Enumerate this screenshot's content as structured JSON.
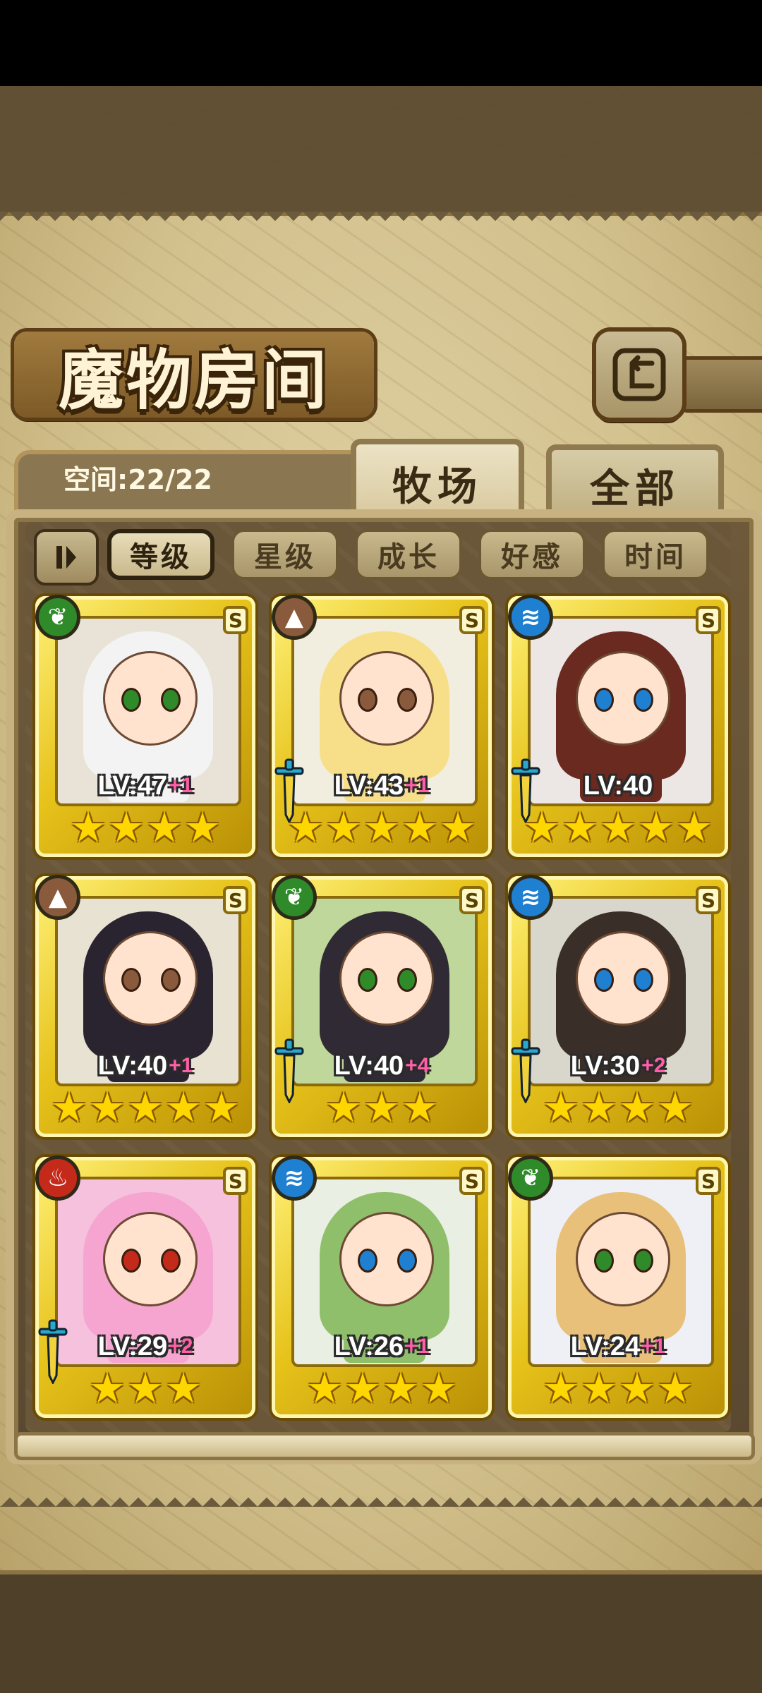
{
  "header": {
    "title": "魔物房间",
    "capacity_label": "空间:22/22"
  },
  "tabs": [
    {
      "label": "牧场",
      "active": true
    },
    {
      "label": "全部",
      "active": false
    }
  ],
  "sort": {
    "toggle_icon": "pause-sort-icon",
    "buttons": [
      {
        "label": "等级",
        "active": true
      },
      {
        "label": "星级",
        "active": false
      },
      {
        "label": "成长",
        "active": false
      },
      {
        "label": "好感",
        "active": false
      },
      {
        "label": "时间",
        "active": false
      }
    ]
  },
  "monsters": [
    {
      "element": "leaf",
      "element_color": "#2f8a2a",
      "level": "LV:47",
      "bonus": "+1",
      "stars": 4,
      "sword": false,
      "hair": "#f3f3f3",
      "bg": "#e9e2d6"
    },
    {
      "element": "earth",
      "element_color": "#8a5a3c",
      "level": "LV:43",
      "bonus": "+1",
      "stars": 5,
      "sword": true,
      "hair": "#f7df8a",
      "bg": "#f1eee0"
    },
    {
      "element": "water",
      "element_color": "#1f7fd0",
      "level": "LV:40",
      "bonus": "",
      "stars": 5,
      "sword": true,
      "hair": "#6a2a20",
      "bg": "#ece6e4"
    },
    {
      "element": "earth",
      "element_color": "#8a5a3c",
      "level": "LV:40",
      "bonus": "+1",
      "stars": 5,
      "sword": false,
      "hair": "#2a2430",
      "bg": "#e8e2d2"
    },
    {
      "element": "leaf",
      "element_color": "#2f8a2a",
      "level": "LV:40",
      "bonus": "+4",
      "stars": 3,
      "sword": true,
      "hair": "#2f2a33",
      "bg": "#bfd79a"
    },
    {
      "element": "water",
      "element_color": "#1f7fd0",
      "level": "LV:30",
      "bonus": "+2",
      "stars": 4,
      "sword": true,
      "hair": "#3a2e28",
      "bg": "#d9d6cc"
    },
    {
      "element": "fire",
      "element_color": "#c42a1a",
      "level": "LV:29",
      "bonus": "+2",
      "stars": 3,
      "sword": true,
      "hair": "#f5a5cf",
      "bg": "#f6c1dc"
    },
    {
      "element": "water",
      "element_color": "#1f7fd0",
      "level": "LV:26",
      "bonus": "+1",
      "stars": 4,
      "sword": false,
      "hair": "#8fbf6a",
      "bg": "#e9efe2"
    },
    {
      "element": "leaf",
      "element_color": "#2f8a2a",
      "level": "LV:24",
      "bonus": "+1",
      "stars": 4,
      "sword": false,
      "hair": "#e8c07a",
      "bg": "#eef0f5"
    }
  ],
  "rarity_badge": "S",
  "element_icons": {
    "leaf": "❦",
    "earth": "▲",
    "water": "≋",
    "fire": "♨"
  },
  "star_glyph": "★"
}
